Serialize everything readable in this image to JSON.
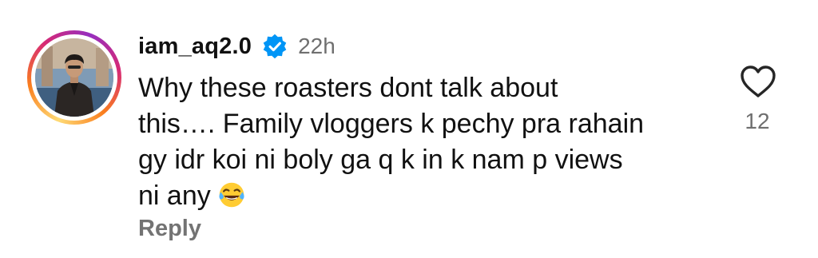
{
  "comment": {
    "username": "iam_aq2.0",
    "verified": true,
    "timestamp": "22h",
    "text_lines": [
      "Why these roasters dont talk about",
      "this…. Family vloggers k pechy pra rahain",
      "gy idr koi ni boly ga q k in k nam p views",
      "ni any"
    ],
    "emoji": "😂",
    "reply_label": "Reply",
    "like_count": "12"
  },
  "icons": {
    "verified": "verified-badge-icon",
    "like": "heart-outline-icon",
    "emoji": "laughing-tears-emoji"
  },
  "colors": {
    "verified_blue": "#0095f6",
    "secondary_text": "#737373",
    "primary_text": "#111111",
    "story_ring_start": "#feda75",
    "story_ring_mid": "#d62976",
    "story_ring_end": "#962fbf"
  }
}
